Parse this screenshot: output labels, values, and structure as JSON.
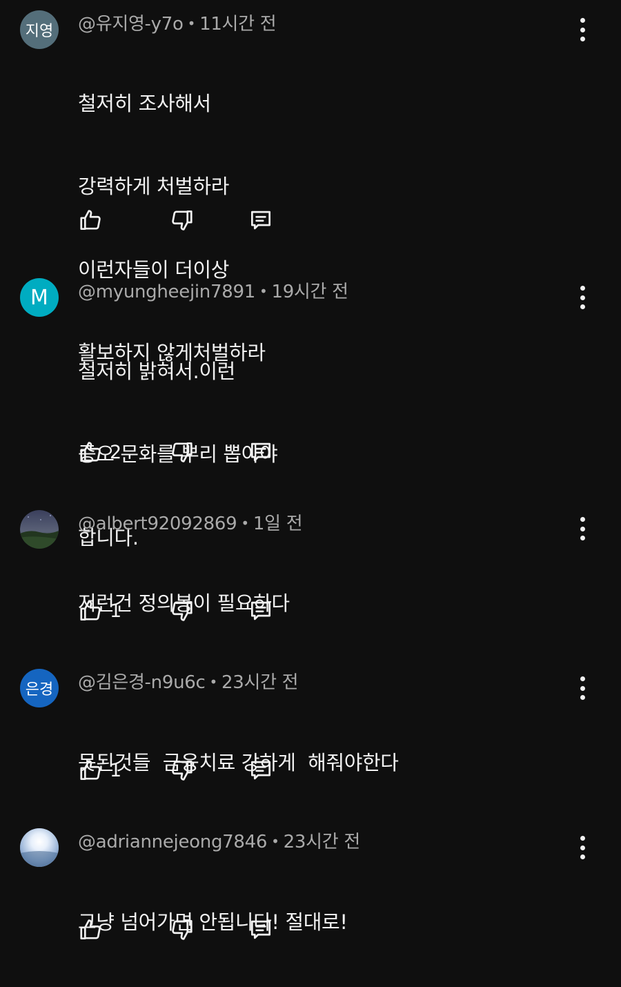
{
  "comments": [
    {
      "avatar_text": "지영",
      "avatar_color": "#546e7a",
      "author": "@유지영-y7o",
      "time": "11시간 전",
      "lines": [
        "철저히 조사해서",
        "강력하게 처벌하라",
        "이런자들이 더이상",
        "활보하지 않게처벌하라"
      ],
      "likes": ""
    },
    {
      "avatar_text": "M",
      "avatar_color": "#00acc1",
      "author": "@myungheejin7891",
      "time": "19시간 전",
      "lines": [
        "철저히 밝혀서.이런",
        "증오 문화를 뿌리 뽑아야",
        "합니다."
      ],
      "likes": "2"
    },
    {
      "avatar_text": "",
      "avatar_color": "#2a2f3a",
      "author": "@albert92092869",
      "time": "1일 전",
      "lines": [
        "저런건 정의봉이 필요하다"
      ],
      "likes": "1"
    },
    {
      "avatar_text": "은경",
      "avatar_color": "#1565c0",
      "author": "@김은경-n9u6c",
      "time": "23시간 전",
      "lines": [
        "못된것들  금융치료 강하게  해줘야한다"
      ],
      "likes": "1"
    },
    {
      "avatar_text": "",
      "avatar_color": "#9fb8d6",
      "author": "@adriannejeong7846",
      "time": "23시간 전",
      "lines": [
        "그냥 넘어가면 안됩니다! 절대로!"
      ],
      "likes": ""
    }
  ],
  "icons": {
    "like": "thumb-up-icon",
    "dislike": "thumb-down-icon",
    "reply": "comment-reply-icon",
    "more": "more-vert-icon"
  }
}
